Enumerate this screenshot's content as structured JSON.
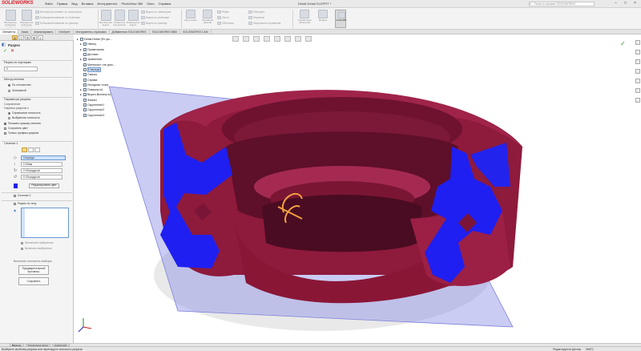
{
  "app": {
    "logo": "SOLIDWORKS",
    "menu": [
      "Файл",
      "Правка",
      "Вид",
      "Вставка",
      "Инструменты",
      "PhotoView 360",
      "Окно",
      "Справка"
    ],
    "document_title": "Detail-Detail.SLDPRT *",
    "search_placeholder": "Поиск в справке SOLIDWORKS"
  },
  "ribbon": {
    "buttons": [
      {
        "label": "Вытянутая бобышка/основание"
      },
      {
        "label": "Повернутая бобышка/основание"
      },
      {
        "label": "Вытянутый вырез"
      },
      {
        "label": "Отверстие под крепеж"
      },
      {
        "label": "Повернутый вырез"
      },
      {
        "label": "Скругление"
      },
      {
        "label": "Линейный массив"
      },
      {
        "label": "Ребро"
      },
      {
        "label": "Уклон"
      },
      {
        "label": "Оболочка"
      },
      {
        "label": "Справочная геометрия"
      },
      {
        "label": "Кривые"
      },
      {
        "label": "Instant3D"
      }
    ],
    "small_items": [
      "Вытянутый элемент по траектории",
      "Бобышка/основание по сечениям",
      "Бобышка/основание по границе",
      "Вырез по траектории",
      "Вырез по сечениям",
      "Вырез по границе",
      "Обернуть",
      "Пересечь",
      "Зеркальное отражение"
    ]
  },
  "command_tabs": [
    "Элементы",
    "Эскиз",
    "Анализировать",
    "DimXpert",
    "Инструменты отрисовки",
    "Добавления SOLIDWORKS",
    "SOLIDWORKS MBD",
    "SOLIDWORKS CAM"
  ],
  "property_manager": {
    "title": "Разрез",
    "section_offset": "Разрез по чертежам",
    "offset_value": "0",
    "method_label": "Метод сечения",
    "method_opts": [
      "По плоскостям",
      "Зональный"
    ],
    "params_label": "Параметры разреза",
    "params_sub": [
      "Сохранение",
      "Нарезки разреза n"
    ],
    "radio_opts": [
      "Справочная плоскость",
      "Выбранная плоскость"
    ],
    "checks": [
      {
        "label": "Показать крышку сечения",
        "on": true
      },
      {
        "label": "Сохранить цвет",
        "on": false
      },
      {
        "label": "Только графика разреза",
        "on": false
      }
    ],
    "section1_label": "Сечение 1",
    "plane_value": "Спереди",
    "values": [
      "0.00мм",
      "0.00градусов",
      "0.00градусов"
    ],
    "edit_color_button": "Редактировать цвет",
    "section2_label": "Сечение 2",
    "section3_label": "Разрез по телу",
    "exclude_selected": "Исключить выбранное",
    "include_selected": "Включить выбранное",
    "include_label": "Включить плоскость выбора",
    "preview_button": "Предварительный просмотр",
    "save_button": "Сохранить"
  },
  "feature_tree": {
    "items": [
      {
        "label": "Detail-Detail (По ум...",
        "expand": "▸"
      },
      {
        "label": "History",
        "expand": "▸"
      },
      {
        "label": "Примечания",
        "expand": "▸"
      },
      {
        "label": "Датчики",
        "expand": ""
      },
      {
        "label": "Уравнения",
        "expand": "▸"
      },
      {
        "label": "Материал <не указ...",
        "expand": ""
      },
      {
        "label": "Спереди",
        "expand": ""
      },
      {
        "label": "Сверху",
        "expand": ""
      },
      {
        "label": "Справа",
        "expand": ""
      },
      {
        "label": "Исходная точка",
        "expand": ""
      },
      {
        "label": "Повернуть1",
        "expand": "▸"
      },
      {
        "label": "Вырез-Вытянуть1",
        "expand": "▸"
      },
      {
        "label": "Фаска1",
        "expand": ""
      },
      {
        "label": "Скругление1",
        "expand": ""
      },
      {
        "label": "Скругление2",
        "expand": ""
      },
      {
        "label": "Скругление3",
        "expand": ""
      }
    ]
  },
  "bottom_tabs": [
    "Модель",
    "Трехмерные виды",
    "Анимация1"
  ],
  "status": {
    "message": "Выберите свойства разреза или перетащите плоскость разреза",
    "right": [
      "Редактируется Деталь",
      "ММГС"
    ]
  },
  "colors": {
    "section_cap": "#1f1ff2",
    "body": "#8e1a3c",
    "plane": "#8a8ee6"
  }
}
